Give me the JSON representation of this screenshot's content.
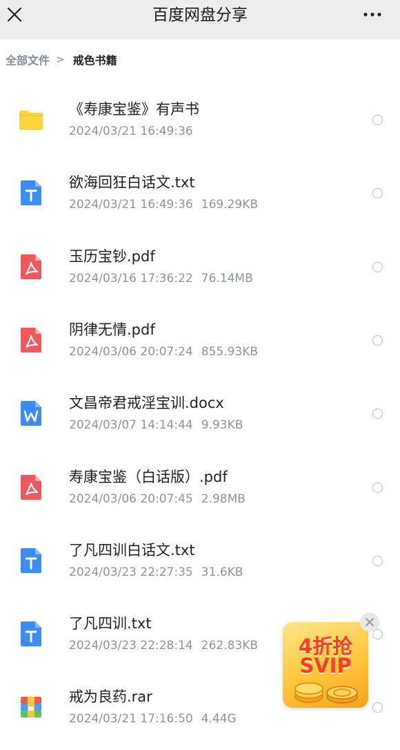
{
  "titlebar": {
    "title": "百度网盘分享"
  },
  "breadcrumb": {
    "root": "全部文件",
    "separator": ">",
    "current": "戒色书籍"
  },
  "files": [
    {
      "name": "《寿康宝鉴》有声书",
      "date": "2024/03/21 16:49:36",
      "size": "",
      "icon": "folder-icon",
      "color": "#ffd43b"
    },
    {
      "name": "欲海回狂白话文.txt",
      "date": "2024/03/21 16:49:36",
      "size": "169.29KB",
      "icon": "txt-file-icon",
      "color": "#3d8cf5"
    },
    {
      "name": "玉历宝钞.pdf",
      "date": "2024/03/16 17:36:22",
      "size": "76.14MB",
      "icon": "pdf-file-icon",
      "color": "#f0585b"
    },
    {
      "name": "阴律无情.pdf",
      "date": "2024/03/06 20:07:24",
      "size": "855.93KB",
      "icon": "pdf-file-icon",
      "color": "#f0585b"
    },
    {
      "name": "文昌帝君戒淫宝训.docx",
      "date": "2024/03/07 14:14:44",
      "size": "9.93KB",
      "icon": "word-file-icon",
      "color": "#3d8cf5"
    },
    {
      "name": "寿康宝鉴（白话版）.pdf",
      "date": "2024/03/06 20:07:45",
      "size": "2.98MB",
      "icon": "pdf-file-icon",
      "color": "#f0585b"
    },
    {
      "name": "了凡四训白话文.txt",
      "date": "2024/03/23 22:27:35",
      "size": "31.6KB",
      "icon": "txt-file-icon",
      "color": "#3d8cf5"
    },
    {
      "name": "了凡四训.txt",
      "date": "2024/03/23 22:28:14",
      "size": "262.83KB",
      "icon": "txt-file-icon",
      "color": "#3d8cf5"
    },
    {
      "name": "戒为良药.rar",
      "date": "2024/03/21 17:16:50",
      "size": "4.44G",
      "icon": "rar-file-icon",
      "color": "#5cc16b"
    }
  ],
  "promo": {
    "line1": "4折抢",
    "line2": "SVIP"
  }
}
